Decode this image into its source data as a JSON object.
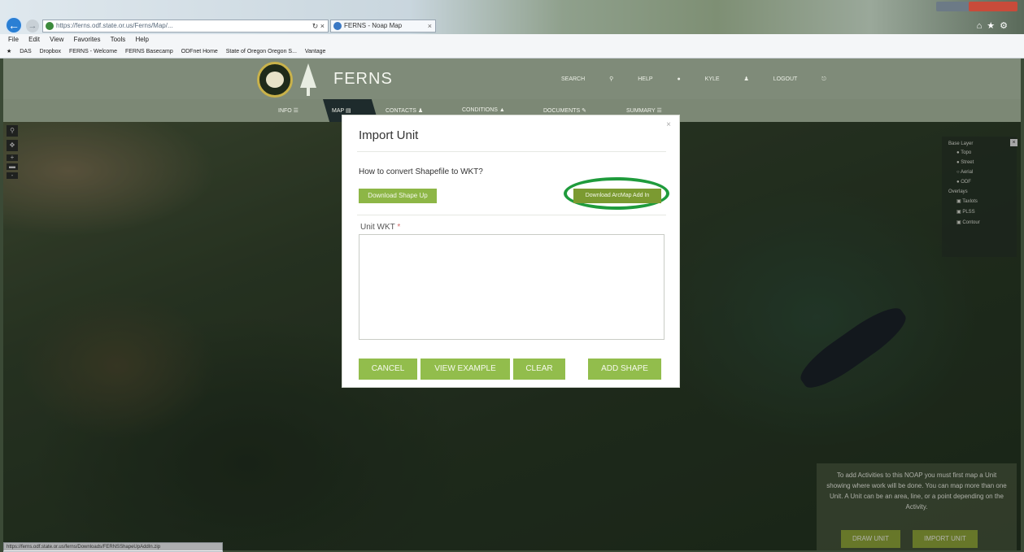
{
  "browser": {
    "address": "https://ferns.odf.state.or.us/Ferns/Map/...",
    "tab_title": "FERNS - Noap Map",
    "menu": [
      "File",
      "Edit",
      "View",
      "Favorites",
      "Tools",
      "Help"
    ],
    "favorites": [
      "DAS",
      "Dropbox",
      "FERNS - Welcome",
      "FERNS Basecamp",
      "ODFnet Home",
      "State of Oregon Oregon S...",
      "Vantage"
    ],
    "status_url": "https://ferns.odf.state.or.us/ferns/Downloads/FERNSShapeUpAddIn.zip"
  },
  "header": {
    "brand": "FERNS",
    "nav": [
      "SEARCH",
      "HELP",
      "KYLE",
      "LOGOUT"
    ]
  },
  "subnav": {
    "items": [
      "INFO",
      "MAP",
      "CONTACTS",
      "CONDITIONS",
      "DOCUMENTS",
      "SUMMARY"
    ],
    "active": "MAP"
  },
  "map": {
    "layer_panel": {
      "base_title": "Base Layer",
      "base_options": [
        "Topo",
        "Street",
        "Aerial",
        "ODF"
      ],
      "overlay_title": "Overlays",
      "overlay_options": [
        "Taxlots",
        "PLSS",
        "Contour"
      ]
    },
    "info_text": "To add Activities to this NOAP you must first map a Unit showing where work will be done. You can map more than one Unit. A Unit can be an area, line, or a point depending on the Activity.",
    "info_buttons": [
      "DRAW UNIT",
      "IMPORT UNIT"
    ]
  },
  "modal": {
    "title": "Import Unit",
    "question": "How to convert Shapefile to WKT?",
    "shape_button": "Download Shape Up",
    "arcmap_button": "Download ArcMap Add In",
    "wkt_label": "Unit WKT",
    "required_mark": "*",
    "wkt_value": "",
    "buttons": {
      "cancel": "CANCEL",
      "view_example": "VIEW EXAMPLE",
      "clear": "CLEAR",
      "add_shape": "ADD SHAPE"
    },
    "close_glyph": "×"
  },
  "colors": {
    "accent_green": "#92bd4c",
    "highlight_ring": "#1f9b3c",
    "header_bg": "#7f8b79"
  }
}
